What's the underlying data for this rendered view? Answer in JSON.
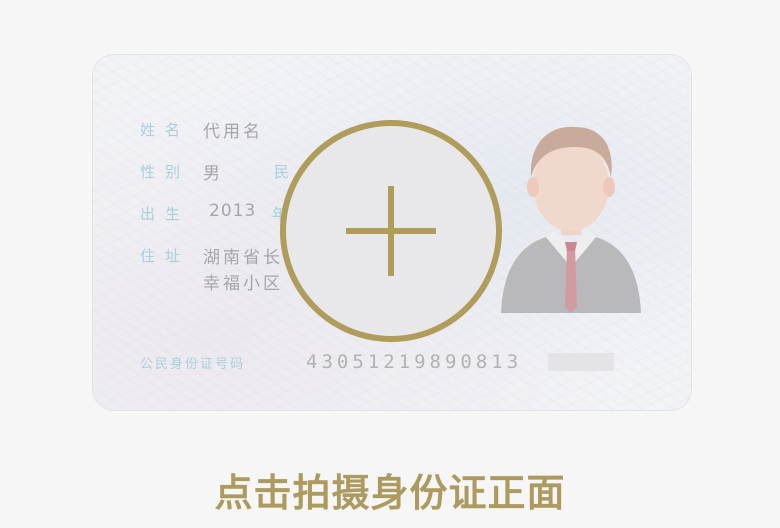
{
  "card": {
    "name_label": "姓名",
    "name_value": "代用名",
    "gender_label": "性别",
    "gender_value": "男",
    "ethnicity_label": "民",
    "birth_label": "出生",
    "birth_year": "2013",
    "birth_year_unit": "年",
    "address_label": "住址",
    "address_line1": "湖南省长",
    "address_line2": "幸福小区",
    "id_label": "公民身份证号码",
    "id_number": "43051219890813"
  },
  "upload": {
    "icon": "plus-icon",
    "caption": "点击拍摄身份证正面"
  },
  "colors": {
    "accent": "#b09c5b",
    "caption": "#ad9a5e",
    "card_label": "#a9cfdd"
  }
}
